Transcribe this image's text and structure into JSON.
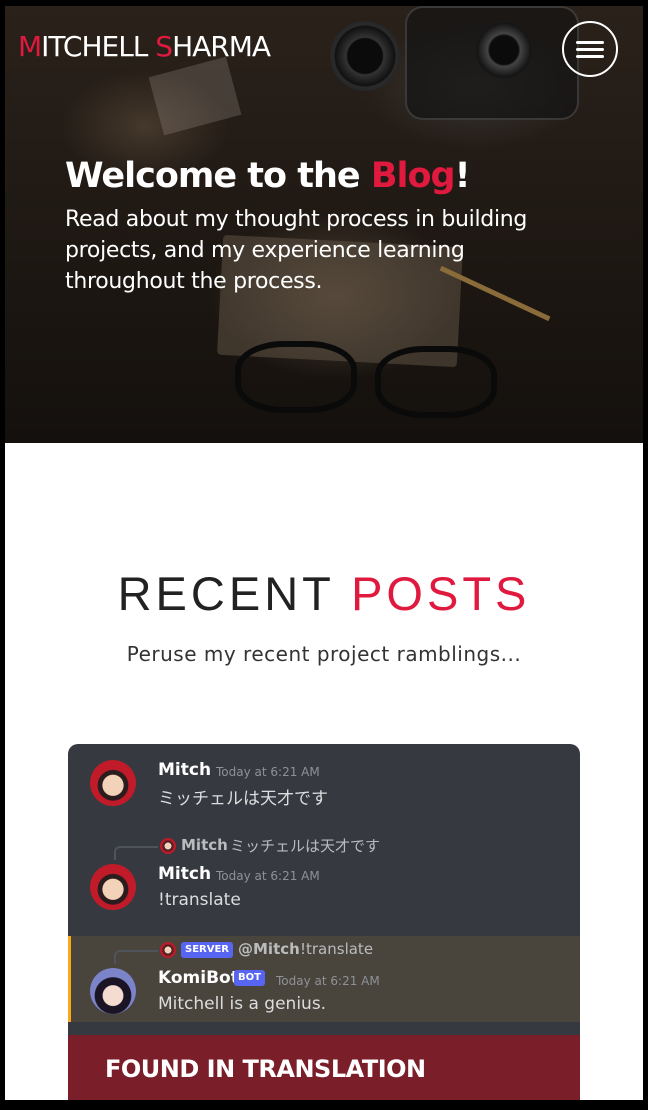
{
  "header": {
    "brand_first_initial": "M",
    "brand_first_rest": "ITCHELL ",
    "brand_last_initial": "S",
    "brand_last_rest": "HARMA",
    "menu_icon": "hamburger-menu-icon"
  },
  "hero": {
    "title_prefix": "Welcome to the ",
    "title_accent": "Blog",
    "title_suffix": "!",
    "subtitle": "Read about my thought process in building projects, and my experience learning throughout the process."
  },
  "recent_posts": {
    "title_main": "RECENT ",
    "title_accent": "POSTS",
    "subtitle": "Peruse my recent project ramblings..."
  },
  "post_card": {
    "messages": [
      {
        "author": "Mitch",
        "time": "Today at 6:21 AM",
        "text": "ミッチェルは天才です"
      },
      {
        "reply_author": "Mitch",
        "reply_text": "ミッチェルは天才です",
        "author": "Mitch",
        "time": "Today at 6:21 AM",
        "text": "!translate"
      },
      {
        "reply_badge": "SERVER",
        "reply_author": "@Mitch",
        "reply_text": "!translate",
        "author": "KomiBot",
        "author_badge": "BOT",
        "time": "Today at 6:21 AM",
        "text": "Mitchell is a genius."
      }
    ],
    "title": "FOUND IN TRANSLATION"
  },
  "colors": {
    "accent": "#e0193f",
    "discord_bg": "#36393f",
    "banner_bg": "#7a1e29",
    "badge_blue": "#5865f2",
    "highlight_bar": "#faa81a"
  }
}
